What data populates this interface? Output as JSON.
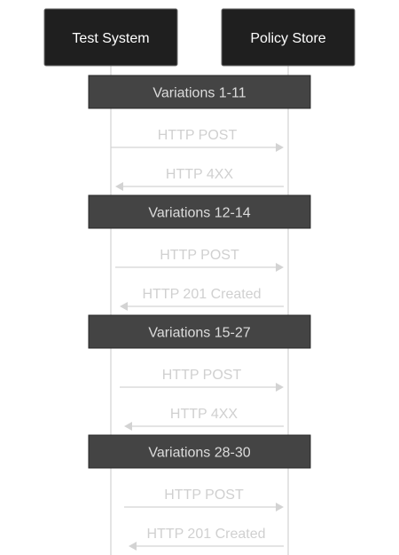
{
  "participants": [
    {
      "id": "test-system",
      "label": "Test System"
    },
    {
      "id": "policy-store",
      "label": "Policy Store"
    }
  ],
  "groups": [
    {
      "title": "Variations 1-11",
      "messages": [
        {
          "label": "HTTP POST",
          "from": "test-system",
          "to": "policy-store"
        },
        {
          "label": "HTTP 4XX",
          "from": "policy-store",
          "to": "test-system"
        }
      ]
    },
    {
      "title": "Variations 12-14",
      "messages": [
        {
          "label": "HTTP POST",
          "from": "test-system",
          "to": "policy-store"
        },
        {
          "label": "HTTP 201 Created",
          "from": "policy-store",
          "to": "test-system"
        }
      ]
    },
    {
      "title": "Variations 15-27",
      "messages": [
        {
          "label": "HTTP POST",
          "from": "test-system",
          "to": "policy-store"
        },
        {
          "label": "HTTP 4XX",
          "from": "policy-store",
          "to": "test-system"
        }
      ]
    },
    {
      "title": "Variations 28-30",
      "messages": [
        {
          "label": "HTTP POST",
          "from": "test-system",
          "to": "policy-store"
        },
        {
          "label": "HTTP 201 Created",
          "from": "policy-store",
          "to": "test-system"
        }
      ]
    }
  ],
  "colors": {
    "participant_fill": "#1f1f1f",
    "note_fill": "#444444",
    "message_color": "#d3d3d3"
  }
}
